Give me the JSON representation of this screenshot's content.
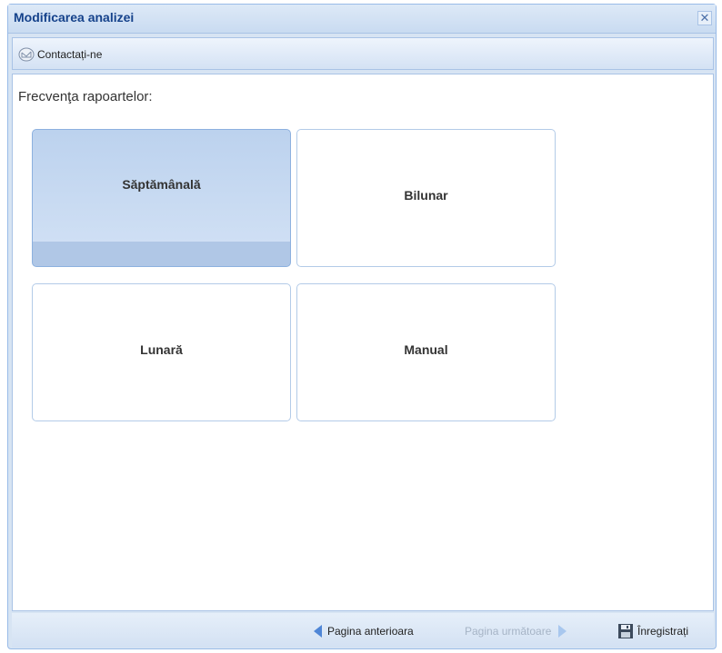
{
  "window": {
    "title": "Modificarea analizei",
    "close_symbol": "✕"
  },
  "toolbar": {
    "contact_label": "Contactați-ne",
    "contact_icon": "envelope-icon"
  },
  "content": {
    "frequency_label": "Frecvenţa rapoartelor:",
    "options": [
      {
        "label": "Săptămânală",
        "selected": true
      },
      {
        "label": "Bilunar",
        "selected": false
      },
      {
        "label": "Lunară",
        "selected": false
      },
      {
        "label": "Manual",
        "selected": false
      }
    ]
  },
  "footer": {
    "prev_label": "Pagina anterioara",
    "next_label": "Pagina următoare",
    "save_label": "Înregistrați",
    "prev_icon": "arrow-left-icon",
    "next_icon": "arrow-right-icon",
    "save_icon": "floppy-disk-icon"
  },
  "colors": {
    "title_text": "#15428b",
    "selected_tile": "#bcd2ee",
    "tile_border": "#b3cbe8",
    "nav_arrow": "#4f86d6",
    "disabled_text": "#a6b4c6"
  }
}
